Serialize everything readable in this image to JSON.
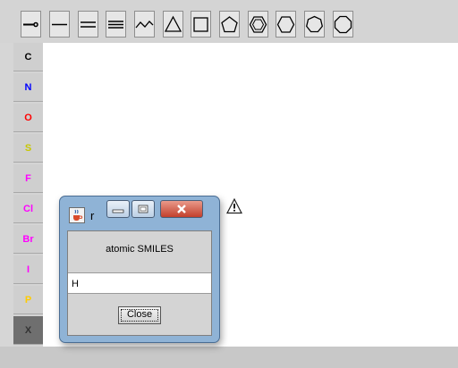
{
  "toolbar": {
    "tools": [
      "arrow-bond",
      "single-bond",
      "double-bond",
      "triple-bond",
      "chain",
      "triangle-ring",
      "square-ring",
      "pentagon-ring",
      "benzene-ring",
      "hexagon-ring",
      "heptagon-ring",
      "octagon-ring"
    ]
  },
  "palette": {
    "elements": [
      {
        "label": "C",
        "color": "#000000"
      },
      {
        "label": "N",
        "color": "#0000ff"
      },
      {
        "label": "O",
        "color": "#ff0000"
      },
      {
        "label": "S",
        "color": "#c8c800"
      },
      {
        "label": "F",
        "color": "#ff00ff"
      },
      {
        "label": "Cl",
        "color": "#ff00ff"
      },
      {
        "label": "Br",
        "color": "#ff00ff"
      },
      {
        "label": "I",
        "color": "#ff00ff"
      },
      {
        "label": "P",
        "color": "#ffcc00"
      },
      {
        "label": "X",
        "color": "#333333"
      }
    ],
    "selected": "X"
  },
  "dialog": {
    "title": "r",
    "label": "atomic SMILES",
    "input_value": "H",
    "close_label": "Close"
  }
}
